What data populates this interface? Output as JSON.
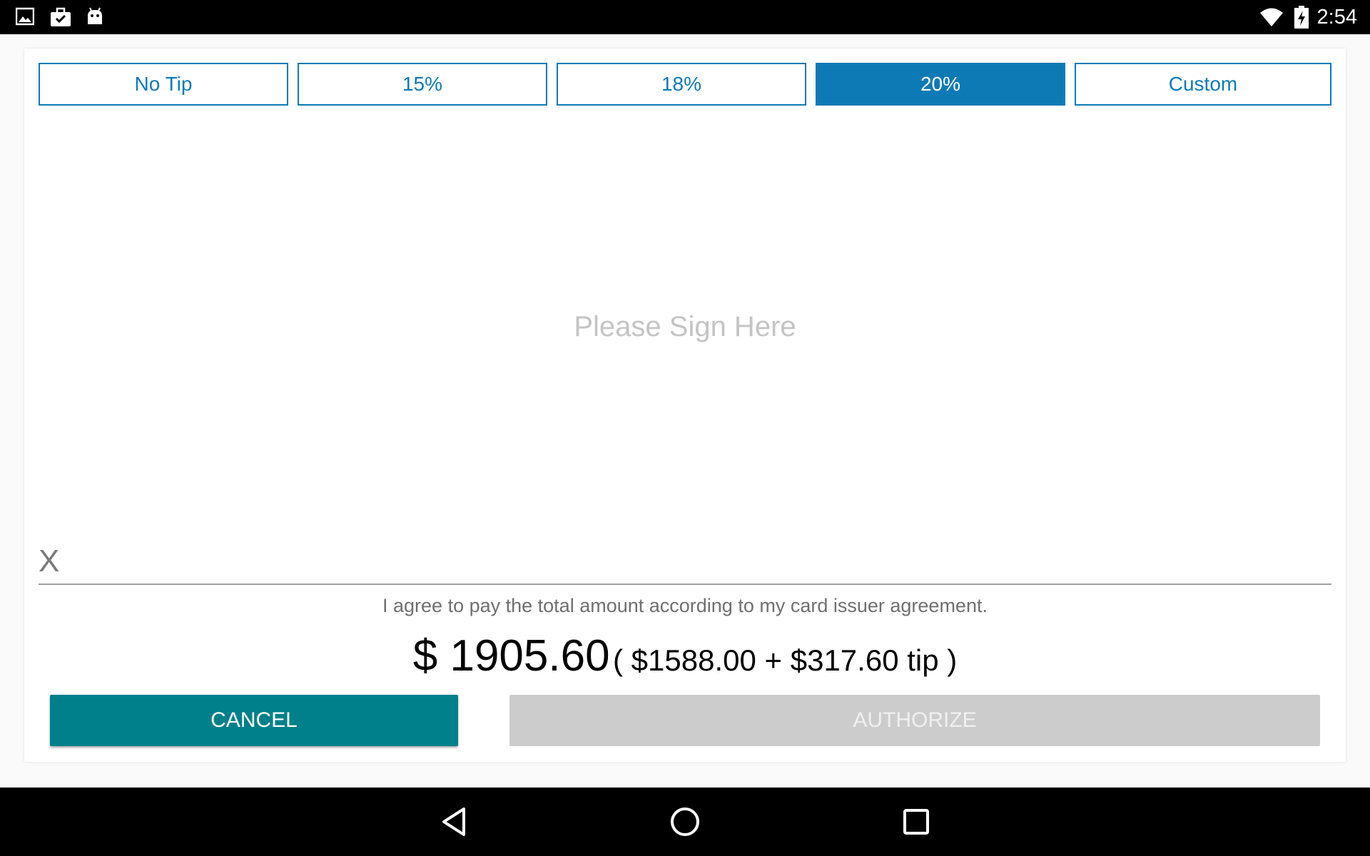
{
  "status_bar": {
    "time": "2:54",
    "left_icons": [
      "image-icon",
      "briefcase-check-icon",
      "android-icon"
    ],
    "right_icons": [
      "wifi-icon",
      "battery-charging-icon"
    ]
  },
  "tip_options": {
    "no_tip": "No Tip",
    "p15": "15%",
    "p18": "18%",
    "p20": "20%",
    "custom": "Custom",
    "selected": "20%"
  },
  "signature": {
    "placeholder": "Please Sign Here",
    "x_mark": "X"
  },
  "agreement_text": "I agree to pay the total amount according to my card issuer agreement.",
  "amount": {
    "total": "$ 1905.60",
    "breakdown": "( $1588.00 + $317.60 tip )"
  },
  "actions": {
    "cancel": "CANCEL",
    "authorize": "AUTHORIZE"
  },
  "nav_bar": {
    "icons": [
      "back-icon",
      "home-icon",
      "recents-icon"
    ]
  },
  "colors": {
    "accent": "#0e7ab5",
    "cancel": "#00808a",
    "disabled": "#cccccc"
  }
}
